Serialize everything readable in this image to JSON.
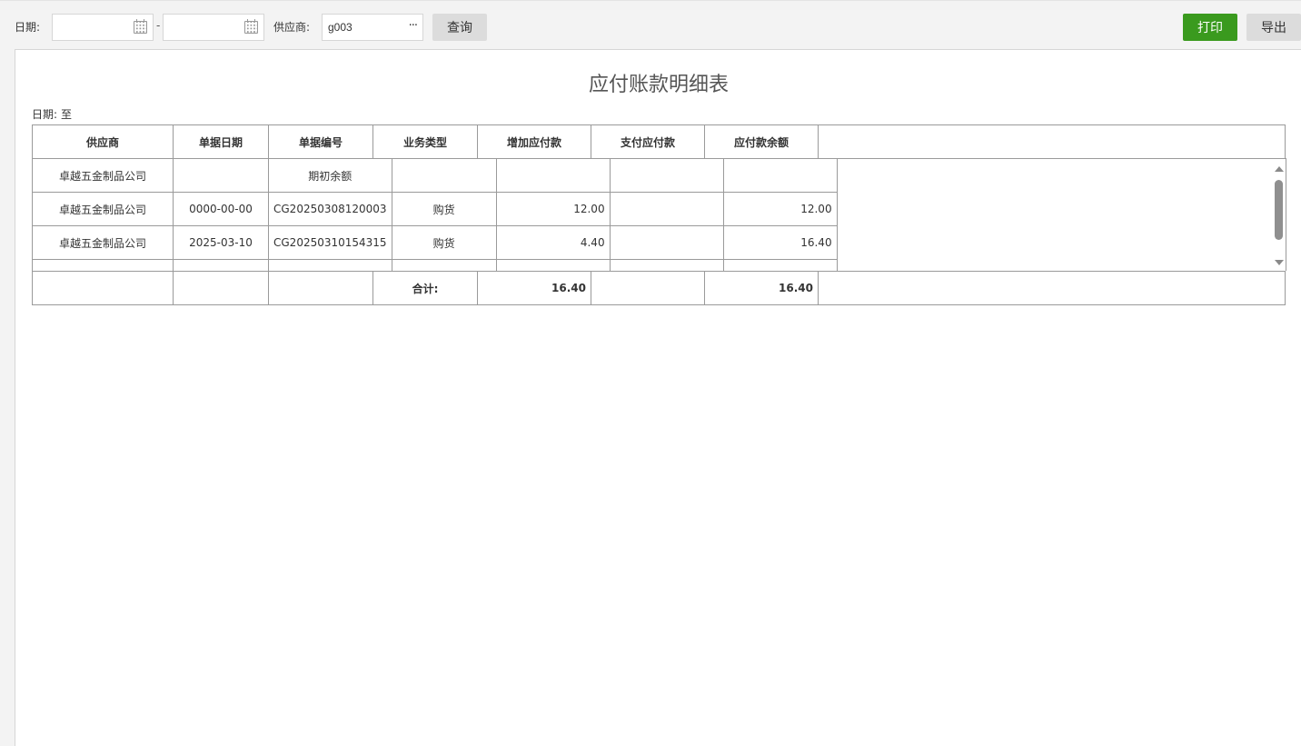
{
  "toolbar": {
    "date_label": "日期:",
    "date_start": "",
    "date_end": "",
    "date_separator": "-",
    "supplier_label": "供应商:",
    "supplier_value": "g003",
    "supplier_more": "···",
    "query_label": "查询",
    "print_label": "打印",
    "export_label": "导出"
  },
  "report": {
    "title": "应付账款明细表",
    "period_label": "日期:",
    "period_to": "至",
    "columns": [
      "供应商",
      "单据日期",
      "单据编号",
      "业务类型",
      "增加应付款",
      "支付应付款",
      "应付款余额"
    ],
    "rows": [
      {
        "supplier": "卓越五金制品公司",
        "date": "",
        "doc_no": "期初余额",
        "type": "",
        "increase": "",
        "pay": "",
        "balance": ""
      },
      {
        "supplier": "卓越五金制品公司",
        "date": "0000-00-00",
        "doc_no": "CG20250308120003",
        "type": "购货",
        "increase": "12.00",
        "pay": "",
        "balance": "12.00"
      },
      {
        "supplier": "卓越五金制品公司",
        "date": "2025-03-10",
        "doc_no": "CG20250310154315",
        "type": "购货",
        "increase": "4.40",
        "pay": "",
        "balance": "16.40"
      }
    ],
    "total_label": "合计:",
    "total_increase": "16.40",
    "total_pay": "",
    "total_balance": "16.40"
  },
  "icons": {
    "calendar": "calendar-icon",
    "more": "more-dots-icon",
    "scroll_up": "arrow-up-icon",
    "scroll_down": "arrow-down-icon"
  }
}
